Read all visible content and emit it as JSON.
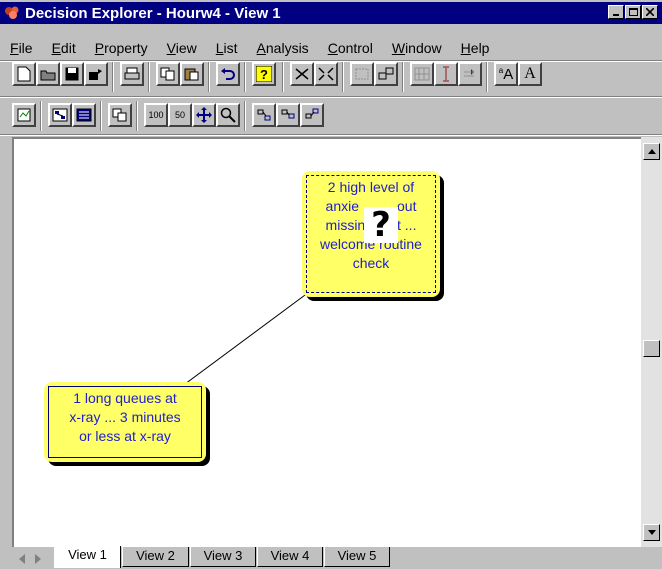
{
  "window": {
    "title": "Decision Explorer - Hourw4 - View 1",
    "title_bg": "#000080",
    "title_fg": "#ffffff"
  },
  "menu": [
    {
      "label": "File"
    },
    {
      "label": "Edit"
    },
    {
      "label": "Property"
    },
    {
      "label": "View"
    },
    {
      "label": "List"
    },
    {
      "label": "Analysis"
    },
    {
      "label": "Control"
    },
    {
      "label": "Window"
    },
    {
      "label": "Help"
    }
  ],
  "toolbar1": [
    {
      "name": "new-icon"
    },
    {
      "name": "open-icon"
    },
    {
      "name": "save-icon"
    },
    {
      "name": "open-folder-icon"
    },
    {
      "name": "print-icon"
    },
    {
      "name": "copy-icon"
    },
    {
      "name": "paste-icon"
    },
    {
      "name": "undo-icon"
    },
    {
      "name": "help-icon"
    },
    {
      "name": "expand-icon"
    },
    {
      "name": "collapse-icon"
    },
    {
      "name": "frame-icon"
    },
    {
      "name": "link-icon"
    },
    {
      "name": "grid-icon"
    },
    {
      "name": "text-cursor-icon"
    },
    {
      "name": "arrow-icon"
    },
    {
      "name": "font-style-icon"
    },
    {
      "name": "font-icon"
    }
  ],
  "toolbar2": [
    {
      "name": "map-icon"
    },
    {
      "name": "overview-icon"
    },
    {
      "name": "list-view-icon"
    },
    {
      "name": "copy-view-icon"
    },
    {
      "name": "zoom-100-icon"
    },
    {
      "name": "zoom-50-icon"
    },
    {
      "name": "pan-icon"
    },
    {
      "name": "zoom-icon"
    },
    {
      "name": "layout-1-icon"
    },
    {
      "name": "layout-2-icon"
    },
    {
      "name": "layout-3-icon"
    }
  ],
  "toolbar_text": {
    "h": "A",
    "z100": "100",
    "z50": "50",
    "font_a": "A"
  },
  "concepts": [
    {
      "id": "2",
      "text": "2 high level of anxiety about missing flight ... welcome routine check",
      "line1": "2 high level of",
      "line2": "anxie",
      "line2b": "out",
      "line3": "missin",
      "line3b": "nt ...",
      "line4": "welcome routine",
      "line5": "check"
    },
    {
      "id": "1",
      "line1": "1 long queues at",
      "line2": "x-ray ... 3 minutes",
      "line3": "or less at x-ray"
    }
  ],
  "concept_color": "#ffff66",
  "concept_text_color": "#2020d0",
  "cursor": "?",
  "tabs": [
    {
      "label": "View 1",
      "active": true
    },
    {
      "label": "View 2"
    },
    {
      "label": "View 3"
    },
    {
      "label": "View 4"
    },
    {
      "label": "View 5"
    }
  ]
}
